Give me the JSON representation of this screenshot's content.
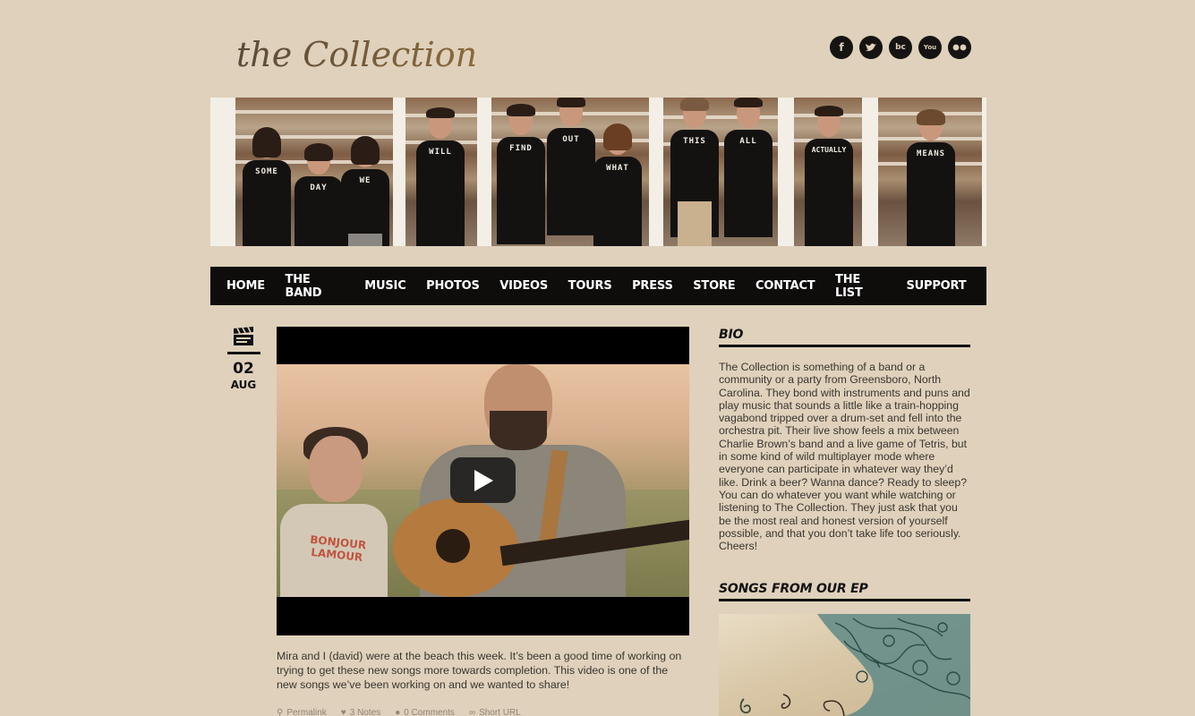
{
  "site": {
    "logo_text": "the Collection",
    "social": [
      {
        "name": "facebook-icon",
        "glyph": "f"
      },
      {
        "name": "twitter-icon",
        "glyph": ""
      },
      {
        "name": "bandcamp-icon",
        "glyph": "bc"
      },
      {
        "name": "youtube-icon",
        "glyph": "You"
      },
      {
        "name": "flickr-icon",
        "glyph": ""
      }
    ]
  },
  "banner": {
    "shirt_words": [
      "SOME",
      "DAY",
      "WE",
      "WILL",
      "FIND",
      "OUT",
      "WHAT",
      "THIS",
      "ALL",
      "ACTUALLY",
      "MEANS"
    ]
  },
  "nav": {
    "items": [
      "HOME",
      "THE BAND",
      "MUSIC",
      "PHOTOS",
      "VIDEOS",
      "TOURS",
      "PRESS",
      "STORE",
      "CONTACT",
      "THE LIST",
      "SUPPORT"
    ]
  },
  "post": {
    "type_icon": "clapperboard-icon",
    "day": "02",
    "month": "AUG",
    "shirt_text": "BONJOUR LAMOUR",
    "body": "Mira and I (david) were at the beach this week. It’s been a good time of working on trying to get these new songs more towards completion. This video is one of the new songs we’ve been working on and we wanted to share!",
    "actions": {
      "permalink": "Permalink",
      "notes": "3 Notes",
      "comments": "0 Comments",
      "short_url": "Short URL"
    }
  },
  "sidebar": {
    "bio_title": "BIO",
    "bio_text": "The Collection is something of a band or a community or a party from Greensboro, North Carolina. They bond with instruments and puns and play music that sounds a little like a train-hopping vagabond tripped over a drum-set and fell into the orchestra pit. Their live show feels a mix between Charlie Brown’s band and a live game of Tetris, but in some kind of wild multiplayer mode where everyone can participate in whatever way they’d like. Drink a beer? Wanna dance? Ready to sleep? You can do whatever you want while watching or listening to The Collection. They just ask that you be the most real and honest version of yourself possible, and that you don’t take life too seriously. Cheers!",
    "ep_title": "SONGS FROM OUR EP"
  }
}
